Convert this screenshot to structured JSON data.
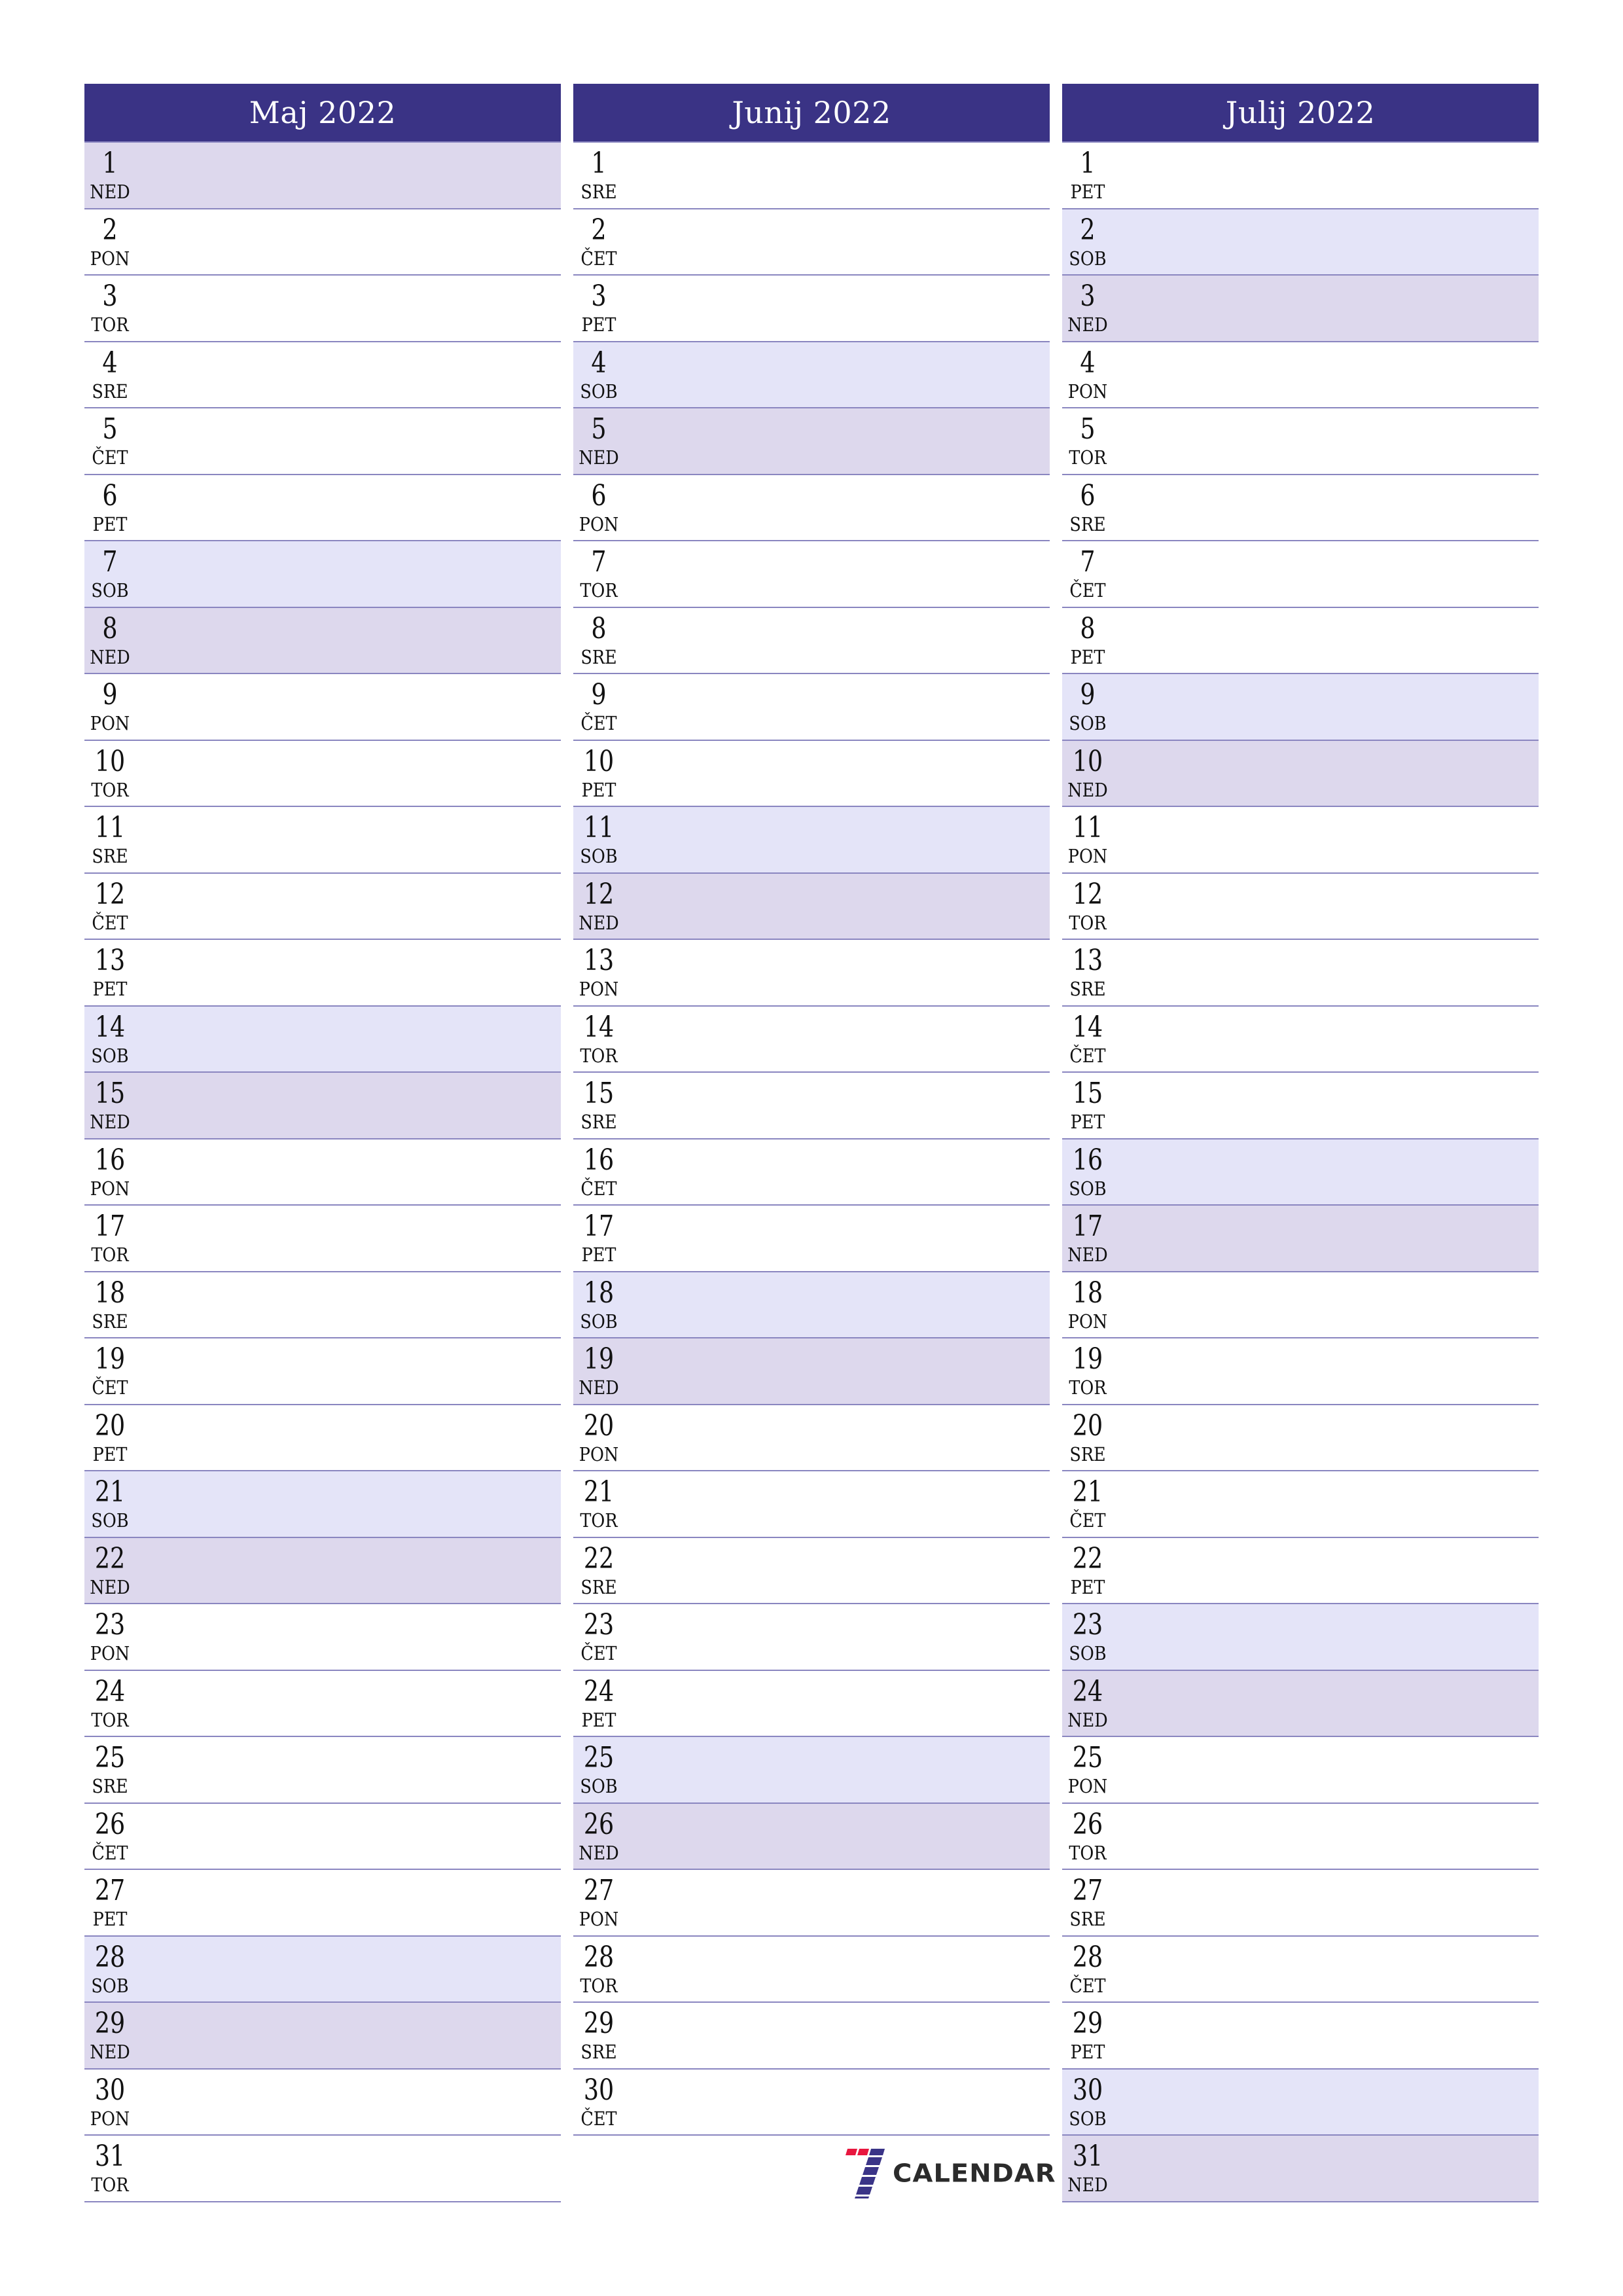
{
  "colors": {
    "header_bg": "#3a3385",
    "header_text": "#ffffff",
    "saturday_bg": "#e4e4f8",
    "sunday_bg": "#ddd8ed",
    "divider": "#8a86c0",
    "logo_red": "#e8173f",
    "logo_blue": "#3a3487"
  },
  "months": [
    {
      "title": "Maj 2022",
      "days": [
        {
          "num": "1",
          "abbr": "NED",
          "type": "sun"
        },
        {
          "num": "2",
          "abbr": "PON",
          "type": ""
        },
        {
          "num": "3",
          "abbr": "TOR",
          "type": ""
        },
        {
          "num": "4",
          "abbr": "SRE",
          "type": ""
        },
        {
          "num": "5",
          "abbr": "ČET",
          "type": ""
        },
        {
          "num": "6",
          "abbr": "PET",
          "type": ""
        },
        {
          "num": "7",
          "abbr": "SOB",
          "type": "sat"
        },
        {
          "num": "8",
          "abbr": "NED",
          "type": "sun"
        },
        {
          "num": "9",
          "abbr": "PON",
          "type": ""
        },
        {
          "num": "10",
          "abbr": "TOR",
          "type": ""
        },
        {
          "num": "11",
          "abbr": "SRE",
          "type": ""
        },
        {
          "num": "12",
          "abbr": "ČET",
          "type": ""
        },
        {
          "num": "13",
          "abbr": "PET",
          "type": ""
        },
        {
          "num": "14",
          "abbr": "SOB",
          "type": "sat"
        },
        {
          "num": "15",
          "abbr": "NED",
          "type": "sun"
        },
        {
          "num": "16",
          "abbr": "PON",
          "type": ""
        },
        {
          "num": "17",
          "abbr": "TOR",
          "type": ""
        },
        {
          "num": "18",
          "abbr": "SRE",
          "type": ""
        },
        {
          "num": "19",
          "abbr": "ČET",
          "type": ""
        },
        {
          "num": "20",
          "abbr": "PET",
          "type": ""
        },
        {
          "num": "21",
          "abbr": "SOB",
          "type": "sat"
        },
        {
          "num": "22",
          "abbr": "NED",
          "type": "sun"
        },
        {
          "num": "23",
          "abbr": "PON",
          "type": ""
        },
        {
          "num": "24",
          "abbr": "TOR",
          "type": ""
        },
        {
          "num": "25",
          "abbr": "SRE",
          "type": ""
        },
        {
          "num": "26",
          "abbr": "ČET",
          "type": ""
        },
        {
          "num": "27",
          "abbr": "PET",
          "type": ""
        },
        {
          "num": "28",
          "abbr": "SOB",
          "type": "sat"
        },
        {
          "num": "29",
          "abbr": "NED",
          "type": "sun"
        },
        {
          "num": "30",
          "abbr": "PON",
          "type": ""
        },
        {
          "num": "31",
          "abbr": "TOR",
          "type": ""
        }
      ]
    },
    {
      "title": "Junij 2022",
      "days": [
        {
          "num": "1",
          "abbr": "SRE",
          "type": ""
        },
        {
          "num": "2",
          "abbr": "ČET",
          "type": ""
        },
        {
          "num": "3",
          "abbr": "PET",
          "type": ""
        },
        {
          "num": "4",
          "abbr": "SOB",
          "type": "sat"
        },
        {
          "num": "5",
          "abbr": "NED",
          "type": "sun"
        },
        {
          "num": "6",
          "abbr": "PON",
          "type": ""
        },
        {
          "num": "7",
          "abbr": "TOR",
          "type": ""
        },
        {
          "num": "8",
          "abbr": "SRE",
          "type": ""
        },
        {
          "num": "9",
          "abbr": "ČET",
          "type": ""
        },
        {
          "num": "10",
          "abbr": "PET",
          "type": ""
        },
        {
          "num": "11",
          "abbr": "SOB",
          "type": "sat"
        },
        {
          "num": "12",
          "abbr": "NED",
          "type": "sun"
        },
        {
          "num": "13",
          "abbr": "PON",
          "type": ""
        },
        {
          "num": "14",
          "abbr": "TOR",
          "type": ""
        },
        {
          "num": "15",
          "abbr": "SRE",
          "type": ""
        },
        {
          "num": "16",
          "abbr": "ČET",
          "type": ""
        },
        {
          "num": "17",
          "abbr": "PET",
          "type": ""
        },
        {
          "num": "18",
          "abbr": "SOB",
          "type": "sat"
        },
        {
          "num": "19",
          "abbr": "NED",
          "type": "sun"
        },
        {
          "num": "20",
          "abbr": "PON",
          "type": ""
        },
        {
          "num": "21",
          "abbr": "TOR",
          "type": ""
        },
        {
          "num": "22",
          "abbr": "SRE",
          "type": ""
        },
        {
          "num": "23",
          "abbr": "ČET",
          "type": ""
        },
        {
          "num": "24",
          "abbr": "PET",
          "type": ""
        },
        {
          "num": "25",
          "abbr": "SOB",
          "type": "sat"
        },
        {
          "num": "26",
          "abbr": "NED",
          "type": "sun"
        },
        {
          "num": "27",
          "abbr": "PON",
          "type": ""
        },
        {
          "num": "28",
          "abbr": "TOR",
          "type": ""
        },
        {
          "num": "29",
          "abbr": "SRE",
          "type": ""
        },
        {
          "num": "30",
          "abbr": "ČET",
          "type": ""
        }
      ]
    },
    {
      "title": "Julij 2022",
      "days": [
        {
          "num": "1",
          "abbr": "PET",
          "type": ""
        },
        {
          "num": "2",
          "abbr": "SOB",
          "type": "sat"
        },
        {
          "num": "3",
          "abbr": "NED",
          "type": "sun"
        },
        {
          "num": "4",
          "abbr": "PON",
          "type": ""
        },
        {
          "num": "5",
          "abbr": "TOR",
          "type": ""
        },
        {
          "num": "6",
          "abbr": "SRE",
          "type": ""
        },
        {
          "num": "7",
          "abbr": "ČET",
          "type": ""
        },
        {
          "num": "8",
          "abbr": "PET",
          "type": ""
        },
        {
          "num": "9",
          "abbr": "SOB",
          "type": "sat"
        },
        {
          "num": "10",
          "abbr": "NED",
          "type": "sun"
        },
        {
          "num": "11",
          "abbr": "PON",
          "type": ""
        },
        {
          "num": "12",
          "abbr": "TOR",
          "type": ""
        },
        {
          "num": "13",
          "abbr": "SRE",
          "type": ""
        },
        {
          "num": "14",
          "abbr": "ČET",
          "type": ""
        },
        {
          "num": "15",
          "abbr": "PET",
          "type": ""
        },
        {
          "num": "16",
          "abbr": "SOB",
          "type": "sat"
        },
        {
          "num": "17",
          "abbr": "NED",
          "type": "sun"
        },
        {
          "num": "18",
          "abbr": "PON",
          "type": ""
        },
        {
          "num": "19",
          "abbr": "TOR",
          "type": ""
        },
        {
          "num": "20",
          "abbr": "SRE",
          "type": ""
        },
        {
          "num": "21",
          "abbr": "ČET",
          "type": ""
        },
        {
          "num": "22",
          "abbr": "PET",
          "type": ""
        },
        {
          "num": "23",
          "abbr": "SOB",
          "type": "sat"
        },
        {
          "num": "24",
          "abbr": "NED",
          "type": "sun"
        },
        {
          "num": "25",
          "abbr": "PON",
          "type": ""
        },
        {
          "num": "26",
          "abbr": "TOR",
          "type": ""
        },
        {
          "num": "27",
          "abbr": "SRE",
          "type": ""
        },
        {
          "num": "28",
          "abbr": "ČET",
          "type": ""
        },
        {
          "num": "29",
          "abbr": "PET",
          "type": ""
        },
        {
          "num": "30",
          "abbr": "SOB",
          "type": "sat"
        },
        {
          "num": "31",
          "abbr": "NED",
          "type": "sun"
        }
      ]
    }
  ],
  "logo": {
    "text": "CALENDAR",
    "icon": "seven-mark-icon"
  }
}
